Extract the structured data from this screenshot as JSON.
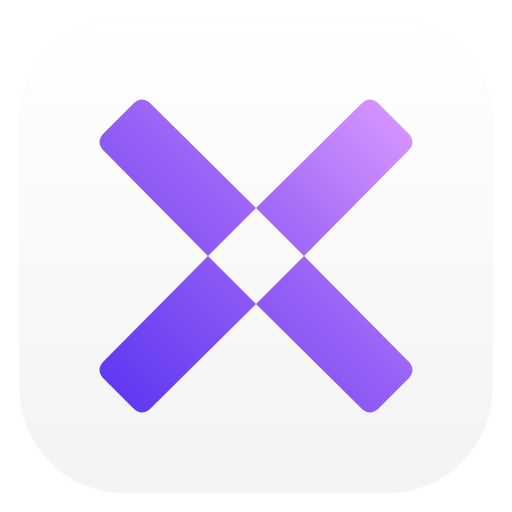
{
  "icon": {
    "name": "x-logo-icon",
    "colors": {
      "background_top": "#ffffff",
      "background_bottom": "#f3f3f6",
      "gradient_start": "#5a34f0",
      "gradient_mid": "#9a64f6",
      "gradient_end": "#dc9bff"
    }
  }
}
